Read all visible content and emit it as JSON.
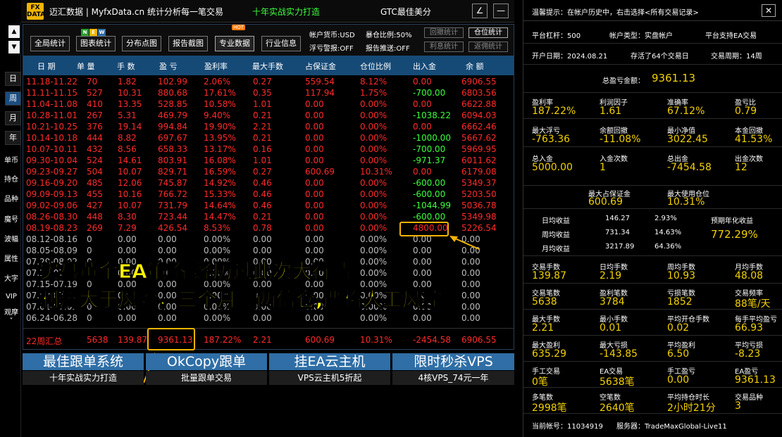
{
  "titlebar": {
    "logo_top": "FX",
    "logo_bottom": "DATA",
    "title": "迈汇数据 | MyfxData.cn  统计分析每一笔交易",
    "slogan": "十年实战实力打造",
    "gtc": "GTC最佳美分",
    "edit_btn": "∠",
    "min_btn": "—"
  },
  "rail": {
    "up": "▲",
    "down": "▼",
    "periods": [
      "日",
      "周",
      "月",
      "年"
    ],
    "tools": [
      "单币",
      "持仓",
      "品种",
      "魔号",
      "波幅",
      "属性",
      "大字",
      "VIP",
      "观摩"
    ],
    "more": "˅"
  },
  "buttons": {
    "all": "全局统计",
    "chart": "图表统计",
    "dist": "分布点图",
    "report": "报告截图",
    "pro": "专业数据",
    "industry": "行业信息",
    "badge_n": "N",
    "badge_e": "E",
    "badge_w": "W",
    "hot": "HOT"
  },
  "info": {
    "currency": "帐户货币:USD",
    "exposure": "暴仓比例:50%",
    "float_alert": "浮亏警报:OFF",
    "report_push": "报告推送:OFF",
    "drawdown": "回撤统计",
    "position": "仓位统计",
    "interest": "利息统计",
    "rebate": "返佣统计"
  },
  "table": {
    "headers": [
      "日 期",
      "单 量",
      "手 数",
      "盈 亏",
      "盈利率",
      "最大手数",
      "占保证金",
      "仓位比例",
      "出入金",
      "余 额"
    ],
    "rows": [
      {
        "c": [
          "11.18-11.22",
          "70",
          "1.82",
          "102.99",
          "2.06%",
          "0.27",
          "559.54",
          "8.12%",
          "0.00",
          "6906.55"
        ],
        "t": "red",
        "f": ""
      },
      {
        "c": [
          "11.11-11.15",
          "527",
          "10.31",
          "880.68",
          "17.61%",
          "0.35",
          "117.94",
          "1.75%",
          "-700.00",
          "6803.56"
        ],
        "t": "red",
        "f": "green"
      },
      {
        "c": [
          "11.04-11.08",
          "410",
          "13.35",
          "528.85",
          "10.58%",
          "1.01",
          "0.00",
          "0.00%",
          "0.00",
          "6622.88"
        ],
        "t": "red",
        "f": ""
      },
      {
        "c": [
          "10.28-11.01",
          "267",
          "5.31",
          "469.79",
          "9.40%",
          "0.21",
          "0.00",
          "0.00%",
          "-1038.22",
          "6094.03"
        ],
        "t": "red",
        "f": "green"
      },
      {
        "c": [
          "10.21-10.25",
          "376",
          "19.14",
          "994.84",
          "19.90%",
          "2.21",
          "0.00",
          "0.00%",
          "0.00",
          "6662.46"
        ],
        "t": "red",
        "f": ""
      },
      {
        "c": [
          "10.14-10.18",
          "444",
          "8.82",
          "697.67",
          "13.95%",
          "0.21",
          "0.00",
          "0.00%",
          "-1000.00",
          "5667.62"
        ],
        "t": "red",
        "f": "green"
      },
      {
        "c": [
          "10.07-10.11",
          "432",
          "8.56",
          "658.33",
          "13.17%",
          "0.16",
          "0.00",
          "0.00%",
          "-700.00",
          "5969.95"
        ],
        "t": "red",
        "f": "green"
      },
      {
        "c": [
          "09.30-10.04",
          "524",
          "14.61",
          "803.91",
          "16.08%",
          "1.01",
          "0.00",
          "0.00%",
          "-971.37",
          "6011.62"
        ],
        "t": "red",
        "f": "green"
      },
      {
        "c": [
          "09.23-09.27",
          "504",
          "10.07",
          "829.71",
          "16.59%",
          "0.27",
          "600.69",
          "10.31%",
          "0.00",
          "6179.08"
        ],
        "t": "red",
        "f": ""
      },
      {
        "c": [
          "09.16-09.20",
          "485",
          "12.06",
          "745.87",
          "14.92%",
          "0.46",
          "0.00",
          "0.00%",
          "-600.00",
          "5349.37"
        ],
        "t": "red",
        "f": "green"
      },
      {
        "c": [
          "09.09-09.13",
          "455",
          "10.16",
          "766.72",
          "15.33%",
          "0.46",
          "0.00",
          "0.00%",
          "-600.00",
          "5203.50"
        ],
        "t": "red",
        "f": "green"
      },
      {
        "c": [
          "09.02-09.06",
          "427",
          "10.07",
          "731.79",
          "14.64%",
          "0.46",
          "0.00",
          "0.00%",
          "-1044.99",
          "5036.78"
        ],
        "t": "red",
        "f": "green"
      },
      {
        "c": [
          "08.26-08.30",
          "448",
          "8.30",
          "723.44",
          "14.47%",
          "0.21",
          "0.00",
          "0.00%",
          "-600.00",
          "5349.98"
        ],
        "t": "red",
        "f": "green"
      },
      {
        "c": [
          "08.19-08.23",
          "269",
          "7.29",
          "426.54",
          "8.53%",
          "0.78",
          "0.00",
          "0.00%",
          "4800.00",
          "5226.54"
        ],
        "t": "red",
        "f": "red"
      },
      {
        "c": [
          "08.12-08.16",
          "0",
          "0.00",
          "0.00",
          "0.00%",
          "0.00",
          "0.00",
          "0.00%",
          "0.00",
          "0.00"
        ],
        "t": "gray",
        "f": ""
      },
      {
        "c": [
          "08.05-08.09",
          "0",
          "0.00",
          "0.00",
          "0.00%",
          "0.00",
          "0.00",
          "0.00%",
          "0.00",
          "0.00"
        ],
        "t": "gray",
        "f": ""
      },
      {
        "c": [
          "07.29-08.02",
          "0",
          "0.00",
          "0.00",
          "0.00%",
          "0.00",
          "0.00",
          "0.00%",
          "0.00",
          "0.00"
        ],
        "t": "gray",
        "f": ""
      },
      {
        "c": [
          "07.22-07.26",
          "0",
          "0.00",
          "0.00",
          "0.00%",
          "0.00",
          "0.00",
          "0.00%",
          "0.00",
          "0.00"
        ],
        "t": "gray",
        "f": ""
      },
      {
        "c": [
          "07.15-07.19",
          "0",
          "0.00",
          "0.00",
          "0.00%",
          "0.00",
          "0.00",
          "0.00%",
          "0.00",
          "0.00"
        ],
        "t": "gray",
        "f": ""
      },
      {
        "c": [
          "07.08-07.12",
          "0",
          "0.00",
          "0.00",
          "0.00%",
          "0.00",
          "0.00",
          "0.00%",
          "0.00",
          "0.00"
        ],
        "t": "gray",
        "f": ""
      },
      {
        "c": [
          "07.01-07.05",
          "0",
          "0.00",
          "0.00",
          "0.00%",
          "0.00",
          "0.00",
          "0.00%",
          "0.00",
          "0.00"
        ],
        "t": "gray",
        "f": ""
      },
      {
        "c": [
          "06.24-06.28",
          "0",
          "0.00",
          "0.00",
          "0.00%",
          "0.00",
          "0.00",
          "0.00%",
          "0.00",
          "0.00"
        ],
        "t": "gray",
        "f": ""
      }
    ],
    "total": [
      "22周汇总",
      "5638",
      "139.87",
      "9361.13",
      "187.22%",
      "2.21",
      "600.69",
      "10.31%",
      "-2454.58",
      "6906.55"
    ]
  },
  "banners": [
    {
      "title": "最佳跟单系统",
      "sub": "十年实战实力打造"
    },
    {
      "title": "OkCopy跟单",
      "sub": "批量跟单交易"
    },
    {
      "title": "挂EA云主机",
      "sub": "VPS云主机5折起"
    },
    {
      "title": "限时秒杀VPS",
      "sub": "4核VPS_74元一年"
    }
  ],
  "overlay": {
    "line1": "实盘黄金EA策略 经历过此次大行情",
    "line2": "利润大于风险，三个月翻两倍仓,严格人工风控"
  },
  "stats": {
    "notice": "温馨提示：在帐户历史中，右击选择<所有交易记录>",
    "close": "✕",
    "leverage": "平台杠杆：500",
    "acct_type": "帐户类型：实盘帐户",
    "platform": "平台支持EA交易",
    "open_date": "开户日期：2024.08.21",
    "deals_saved": "存活了64个交易日",
    "cycle": "交易周期：14周",
    "total_profit_lbl": "总盈亏金额：",
    "total_profit": "9361.13",
    "g1": [
      [
        "盈利率",
        "187.22%"
      ],
      [
        "利润因子",
        "1.61"
      ],
      [
        "准确率",
        "67.12%"
      ],
      [
        "盈亏比",
        "0.79"
      ]
    ],
    "g2": [
      [
        "最大浮亏",
        "-763.36"
      ],
      [
        "余额回撤",
        "-11.08%"
      ],
      [
        "最小净值",
        "3022.45"
      ],
      [
        "本金回撤",
        "41.53%"
      ]
    ],
    "g3": [
      [
        "总入金",
        "5000.00"
      ],
      [
        "入金次数",
        "1"
      ],
      [
        "总出金",
        "-7454.58"
      ],
      [
        "出金次数",
        "12"
      ]
    ],
    "g4": [
      [
        "最大占保证金",
        "600.69"
      ],
      [
        "最大使用仓位",
        "10.31%"
      ]
    ],
    "avg": [
      [
        "日均收益",
        "146.27",
        "2.93%"
      ],
      [
        "周均收益",
        "731.34",
        "14.63%"
      ],
      [
        "月均收益",
        "3217.89",
        "64.36%"
      ]
    ],
    "annual_lbl": "预期年化收益",
    "annual": "772.29%",
    "g5": [
      [
        "交易手数",
        "139.87"
      ],
      [
        "日均手数",
        "2.19"
      ],
      [
        "周均手数",
        "10.93"
      ],
      [
        "月均手数",
        "48.08"
      ]
    ],
    "g6": [
      [
        "交易笔数",
        "5638"
      ],
      [
        "盈利笔数",
        "3784"
      ],
      [
        "亏损笔数",
        "1852"
      ],
      [
        "交易频率",
        "88笔/天"
      ]
    ],
    "g7": [
      [
        "最大手数",
        "2.21"
      ],
      [
        "最小手数",
        "0.01"
      ],
      [
        "平均开仓手数",
        "0.02"
      ],
      [
        "每手平均盈亏",
        "66.93"
      ]
    ],
    "g8": [
      [
        "最大盈利",
        "635.29"
      ],
      [
        "最大亏损",
        "-143.85"
      ],
      [
        "平均盈利",
        "6.50"
      ],
      [
        "平均亏损",
        "-8.23"
      ]
    ],
    "g9": [
      [
        "手工交易",
        "0笔"
      ],
      [
        "EA交易",
        "5638笔"
      ],
      [
        "手工盈亏",
        "0.00"
      ],
      [
        "EA盈亏",
        "9361.13"
      ]
    ],
    "g10": [
      [
        "多笔数",
        "2998笔"
      ],
      [
        "空笔数",
        "2640笔"
      ],
      [
        "平均持仓时长",
        "2小时21分"
      ],
      [
        "交易品种",
        "3"
      ]
    ],
    "account": "当前帐号：11034919",
    "server": "服务器：TradeMaxGlobal-Live11"
  },
  "colors": {
    "accent": "#164a76",
    "profit": "#ff2a2a",
    "withdraw": "#3cff3c",
    "highlight": "#f2b400",
    "value": "#f2d100"
  }
}
